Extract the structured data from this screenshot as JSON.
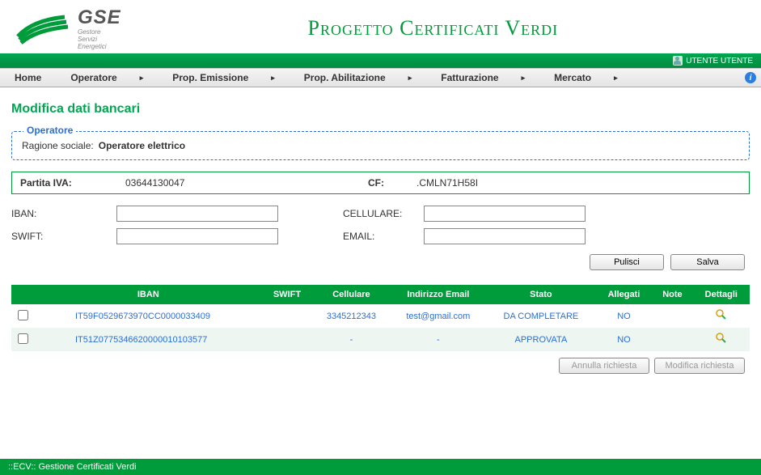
{
  "logo": {
    "gse": "GSE",
    "sub1": "Gestore",
    "sub2": "Servizi",
    "sub3": "Energetici"
  },
  "title": "Progetto Certificati Verdi",
  "user": "UTENTE UTENTE",
  "menu": {
    "home": "Home",
    "operatore": "Operatore",
    "prop_emissione": "Prop. Emissione",
    "prop_abilitazione": "Prop. Abilitazione",
    "fatturazione": "Fatturazione",
    "mercato": "Mercato"
  },
  "page_heading": "Modifica dati bancari",
  "operatore_box": {
    "legend": "Operatore",
    "ragione_label": "Ragione sociale:",
    "ragione_value": "Operatore elettrico"
  },
  "info": {
    "piva_label": "Partita IVA:",
    "piva_value": "03644130047",
    "cf_label": "CF:",
    "cf_value": ".CMLN71H58I"
  },
  "form": {
    "iban_label": "IBAN:",
    "iban_value": "",
    "swift_label": "SWIFT:",
    "swift_value": "",
    "cell_label": "CELLULARE:",
    "cell_value": "",
    "email_label": "EMAIL:",
    "email_value": ""
  },
  "buttons": {
    "pulisci": "Pulisci",
    "salva": "Salva",
    "annulla": "Annulla richiesta",
    "modifica": "Modifica richiesta"
  },
  "table": {
    "headers": {
      "iban": "IBAN",
      "swift": "SWIFT",
      "cell": "Cellulare",
      "email": "Indirizzo Email",
      "stato": "Stato",
      "allegati": "Allegati",
      "note": "Note",
      "dettagli": "Dettagli"
    },
    "rows": [
      {
        "iban": "IT59F0529673970CC0000033409",
        "swift": "",
        "cell": "3345212343",
        "email": "test@gmail.com",
        "stato": "DA COMPLETARE",
        "allegati": "NO",
        "note": ""
      },
      {
        "iban": "IT51Z0775346620000010103577",
        "swift": "",
        "cell": "-",
        "email": "-",
        "stato": "APPROVATA",
        "allegati": "NO",
        "note": ""
      }
    ]
  },
  "footer": "::ECV:: Gestione Certificati Verdi"
}
